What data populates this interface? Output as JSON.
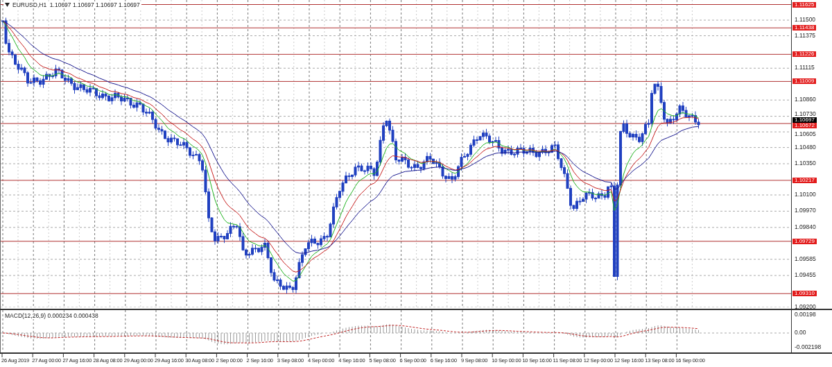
{
  "chart": {
    "title": "EURUSD,H1  1.10697 1.10697 1.10697 1.10697",
    "price_axis": [
      "1.11500",
      "1.11375",
      "1.11115",
      "1.10860",
      "1.10730",
      "1.10605",
      "1.10480",
      "1.10350",
      "1.10100",
      "1.09970",
      "1.09840",
      "1.09585",
      "1.09455",
      "1.09200"
    ],
    "levels": [
      "1.11625",
      "1.11438",
      "1.11226",
      "1.11009",
      "1.10672",
      "1.10217",
      "1.09729",
      "1.09310"
    ],
    "current_price": "1.10697"
  },
  "macd": {
    "title": "MACD(12,26,9) 0.000234 0.000438",
    "axis": [
      "0.00198",
      "0.00",
      "-0.002198"
    ]
  },
  "time_axis": [
    "26 Aug 2019",
    "27 Aug 00:00",
    "27 Aug 16:00",
    "28 Aug 08:00",
    "29 Aug 00:00",
    "29 Aug 16:00",
    "30 Aug 08:00",
    "2 Sep 00:00",
    "2 Sep 16:00",
    "3 Sep 08:00",
    "4 Sep 00:00",
    "4 Sep 16:00",
    "5 Sep 08:00",
    "6 Sep 00:00",
    "6 Sep 16:00",
    "9 Sep 08:00",
    "10 Sep 00:00",
    "10 Sep 16:00",
    "11 Sep 08:00",
    "12 Sep 00:00",
    "12 Sep 16:00",
    "13 Sep 08:00",
    "16 Sep 00:00"
  ]
}
